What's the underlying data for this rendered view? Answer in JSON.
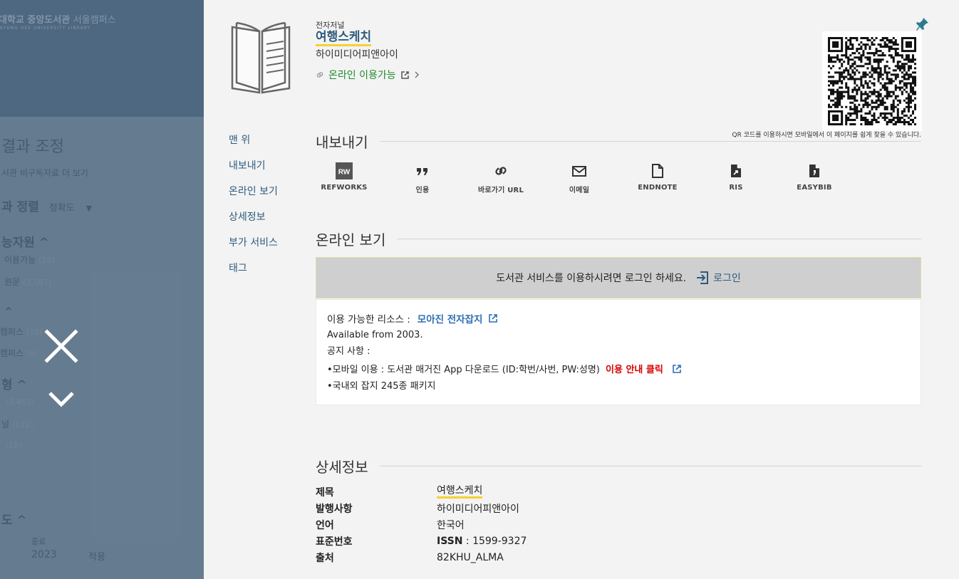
{
  "background": {
    "logo": "대학교 중앙도서관",
    "logo_campus": "서울캠퍼스",
    "logo_sub": "KYUNG HEE UNIVERSITY LIBRARY",
    "refine_title": "결과 조정",
    "refine_sub": "서관 비구독자료 더 보기",
    "sort_label": "과 정렬",
    "sort_value": "정확도",
    "facet1_title": "능자원",
    "facet1_item1": "이용가능",
    "facet1_item1_count": "(18)",
    "facet1_item2": "원문",
    "facet1_item2_count": "(2,587)",
    "facet2_item1": "캠퍼스",
    "facet2_item1_count": "(18)",
    "facet2_item2": "캠퍼스",
    "facet2_item2_count": "(6)",
    "facet3_title": "형",
    "facet3_item1_count": "(3,455)",
    "facet3_item2": "널",
    "facet3_item2_count": "(112)",
    "facet3_item3_count": "(18)",
    "facet4_title": "도",
    "year_from_label": "종료",
    "year_value": "2023",
    "apply_label": "적용"
  },
  "record": {
    "type": "전자저널",
    "title": "여행스케치",
    "publisher": "하이미디어피앤아이",
    "online_label": "온라인 이용가능"
  },
  "qr_caption": "QR 코드를 이용하시면 모바일에서 이 페이지를 쉽게 찾을 수 있습니다.",
  "nav": {
    "top": "맨 위",
    "export": "내보내기",
    "online_view": "온라인 보기",
    "details": "상세정보",
    "services": "부가 서비스",
    "tags": "태그"
  },
  "sections": {
    "export": "내보내기",
    "online_view": "온라인 보기",
    "details": "상세정보"
  },
  "export_tools": [
    {
      "label": "REFWORKS",
      "icon": "refworks-icon",
      "badge": "RW"
    },
    {
      "label": "인용",
      "icon": "quote-icon"
    },
    {
      "label": "바로가기 URL",
      "icon": "link-icon"
    },
    {
      "label": "이메일",
      "icon": "email-icon"
    },
    {
      "label": "ENDNOTE",
      "icon": "endnote-icon"
    },
    {
      "label": "RIS",
      "icon": "ris-icon"
    },
    {
      "label": "EASYBIB",
      "icon": "easybib-icon"
    }
  ],
  "login": {
    "message": "도서관 서비스를 이용하시려면 로그인 하세요.",
    "link": "로그인"
  },
  "resources": {
    "label": "이용 가능한 리소스 :",
    "link": "모아진 전자잡지",
    "available": "Available from 2003.",
    "notice_label": "공지 사항 :",
    "notice1": "•모바일 이용 : 도서관 매거진 App 다운로드 (ID:학번/사번, PW:성명)",
    "notice1_link": "이용 안내 클릭",
    "notice2": "•국내외 잡지 245종 패키지"
  },
  "details": [
    {
      "key": "제목",
      "value": "여행스케치"
    },
    {
      "key": "발행사항",
      "value": "하이미디어피앤아이"
    },
    {
      "key": "언어",
      "value": "한국어"
    },
    {
      "key": "표준번호",
      "value_prefix": "ISSN",
      "value": " : 1599-9327"
    },
    {
      "key": "출처",
      "value": "82KHU_ALMA"
    }
  ],
  "colors": {
    "link_blue": "#2d5b7d",
    "online_green": "#1f8a2c",
    "alert_red": "#d40000",
    "highlight_yellow": "#f5d132"
  }
}
